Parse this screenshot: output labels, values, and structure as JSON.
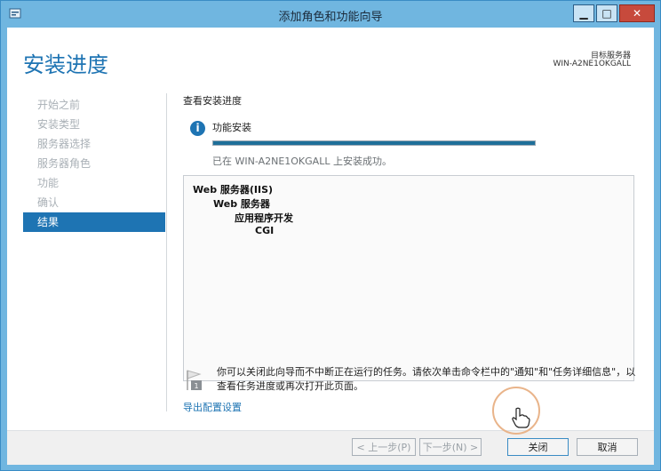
{
  "window": {
    "title": "添加角色和功能向导"
  },
  "header": {
    "heading": "安装进度",
    "target_label": "目标服务器",
    "target_name": "WIN-A2NE1OKGALL"
  },
  "nav": {
    "items": [
      "开始之前",
      "安装类型",
      "服务器选择",
      "服务器角色",
      "功能",
      "确认",
      "结果"
    ],
    "active_index": 6
  },
  "main": {
    "section_title": "查看安装进度",
    "feature_label": "功能安装",
    "progress": 1.0,
    "status_text": "已在 WIN-A2NE1OKGALL 上安装成功。",
    "results": [
      {
        "text": "Web 服务器(IIS)",
        "level": 0
      },
      {
        "text": "Web 服务器",
        "level": 1
      },
      {
        "text": "应用程序开发",
        "level": 2
      },
      {
        "text": "CGI",
        "level": 3
      }
    ],
    "note": "你可以关闭此向导而不中断正在运行的任务。请依次单击命令栏中的\"通知\"和\"任务详细信息\"，以查看任务进度或再次打开此页面。",
    "export_link": "导出配置设置"
  },
  "footer": {
    "prev_label": "< 上一步(P)",
    "next_label": "下一步(N) >",
    "close_label": "关闭",
    "cancel_label": "取消"
  },
  "colors": {
    "accent": "#1e74b3",
    "frame": "#70b6e0",
    "close_button": "#c74a3c",
    "progress_fill": "#1e6f99"
  }
}
